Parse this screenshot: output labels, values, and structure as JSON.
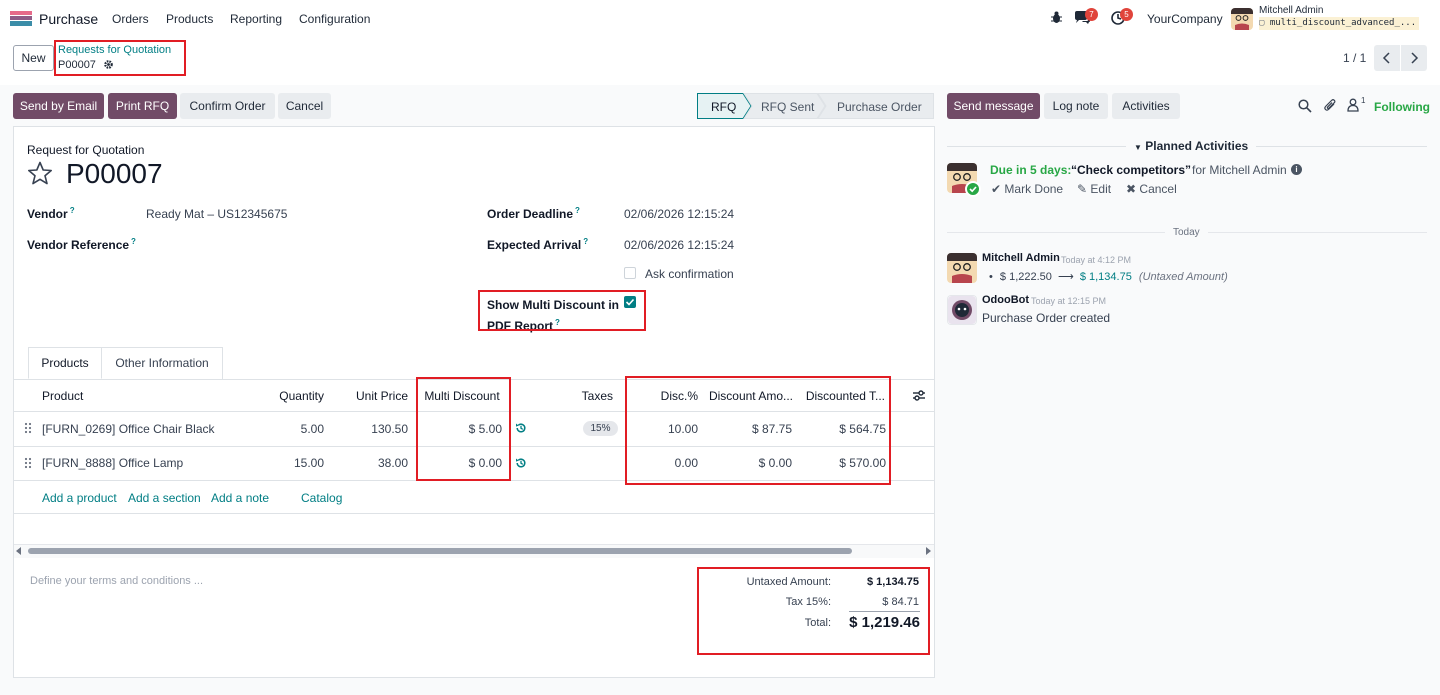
{
  "navbar": {
    "app_name": "Purchase",
    "menus": [
      "Orders",
      "Products",
      "Reporting",
      "Configuration"
    ],
    "messages_count": "7",
    "activities_count": "5",
    "company": "YourCompany",
    "user_name": "Mitchell Admin",
    "db_name": "multi_discount_advanced_..."
  },
  "control": {
    "new_label": "New",
    "breadcrumb_parent": "Requests for Quotation",
    "breadcrumb_current": "P00007",
    "pager": "1 / 1"
  },
  "actions": {
    "send_email": "Send by Email",
    "print_rfq": "Print RFQ",
    "confirm": "Confirm Order",
    "cancel": "Cancel"
  },
  "statusbar": [
    "RFQ",
    "RFQ Sent",
    "Purchase Order"
  ],
  "form": {
    "doc_type": "Request for Quotation",
    "name": "P00007",
    "vendor_label": "Vendor",
    "vendor_value": "Ready Mat – US12345675",
    "vendor_ref_label": "Vendor Reference",
    "order_deadline_label": "Order Deadline",
    "order_deadline_value": "02/06/2026 12:15:24",
    "expected_arrival_label": "Expected Arrival",
    "expected_arrival_value": "02/06/2026 12:15:24",
    "ask_confirmation_label": "Ask confirmation",
    "show_multi_line1": "Show Multi Discount in",
    "show_multi_line2": "PDF Report",
    "help_mark": "?"
  },
  "tabs": [
    "Products",
    "Other Information"
  ],
  "table": {
    "headers": [
      "Product",
      "Quantity",
      "Unit Price",
      "Multi Discount",
      "Taxes",
      "Disc.%",
      "Discount Amo...",
      "Discounted T..."
    ],
    "rows": [
      {
        "product": "[FURN_0269] Office Chair Black",
        "qty": "5.00",
        "price": "130.50",
        "multi": "$ 5.00",
        "tax": "15%",
        "disc": "10.00",
        "disc_amt": "$ 87.75",
        "disc_total": "$ 564.75"
      },
      {
        "product": "[FURN_8888] Office Lamp",
        "qty": "15.00",
        "price": "38.00",
        "multi": "$ 0.00",
        "tax": "",
        "disc": "0.00",
        "disc_amt": "$ 0.00",
        "disc_total": "$ 570.00"
      }
    ],
    "add_product": "Add a product",
    "add_section": "Add a section",
    "add_note": "Add a note",
    "catalog": "Catalog"
  },
  "terms_placeholder": "Define your terms and conditions ...",
  "totals": {
    "untaxed_label": "Untaxed Amount:",
    "untaxed_value": "$ 1,134.75",
    "tax_label": "Tax 15%:",
    "tax_value": "$ 84.71",
    "total_label": "Total:",
    "total_value": "$ 1,219.46"
  },
  "chatter": {
    "send_message": "Send message",
    "log_note": "Log note",
    "activities": "Activities",
    "attachments_count": "1",
    "following": "Following",
    "planned_header": "Planned Activities",
    "due": "Due in 5 days:",
    "activity_title": "“Check competitors”",
    "activity_for": "for Mitchell Admin",
    "mark_done": "Mark Done",
    "edit": "Edit",
    "cancel": "Cancel",
    "today": "Today",
    "msg1_author": "Mitchell Admin",
    "msg1_time": "Today at 4:12 PM",
    "msg1_old": "$ 1,222.50",
    "msg1_new": "$ 1,134.75",
    "msg1_field": "(Untaxed Amount)",
    "msg2_author": "OdooBot",
    "msg2_time": "Today at 12:15 PM",
    "msg2_body": "Purchase Order created"
  },
  "colors": {
    "primary": "#714b67",
    "accent_teal": "#017e84",
    "highlight_red": "#e11d24",
    "due_green": "#28a745",
    "badge_red": "#e0443b"
  }
}
